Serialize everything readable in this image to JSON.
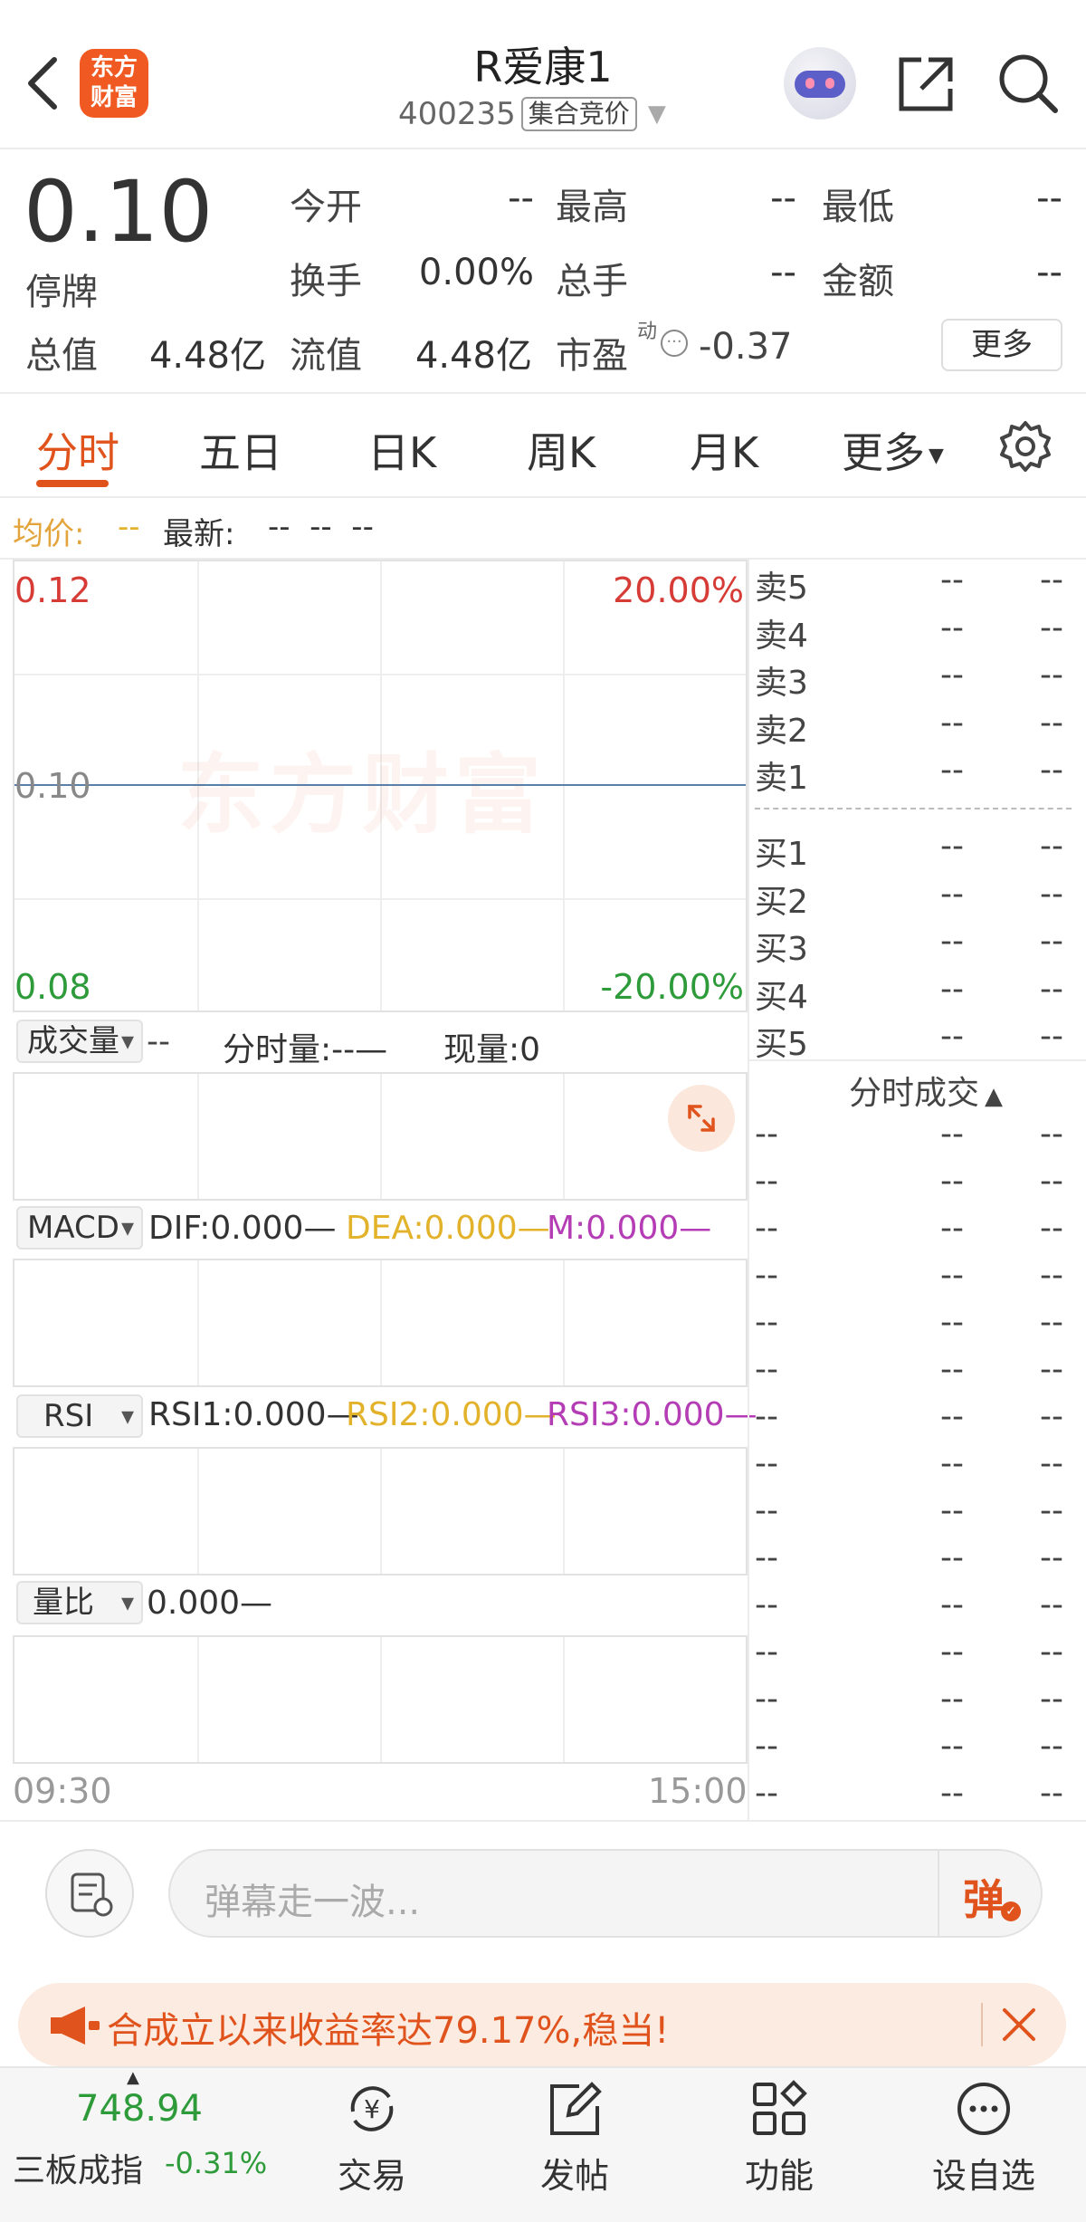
{
  "header": {
    "logo_text": "东方财富",
    "stock_name": "R爱康1",
    "code": "400235",
    "tag": "集合竞价"
  },
  "quote": {
    "price": "0.10",
    "status": "停牌",
    "open_label": "今开",
    "open": "--",
    "high_label": "最高",
    "high": "--",
    "low_label": "最低",
    "low": "--",
    "turnover_label": "换手",
    "turnover": "0.00%",
    "volume_label": "总手",
    "volume": "--",
    "amount_label": "金额",
    "amount": "--",
    "mcap_label": "总值",
    "mcap": "4.48亿",
    "float_label": "流值",
    "float": "4.48亿",
    "pe_label": "市盈",
    "pe_sup": "动",
    "pe": "-0.37",
    "more": "更多"
  },
  "tabs": [
    "分时",
    "五日",
    "日K",
    "周K",
    "月K",
    "更多"
  ],
  "infobar": {
    "avg_label": "均价:",
    "avg": "--",
    "latest_label": "最新:",
    "latest": "--  --  --"
  },
  "chart": {
    "watermark": "东方财富",
    "y_top": "0.12",
    "y_mid": "0.10",
    "y_bot": "0.08",
    "pct_top": "20.00%",
    "pct_bot": "-20.00%",
    "time_start": "09:30",
    "time_end": "15:00",
    "colors": {
      "up": "#d63b36",
      "down": "#2e9b3a",
      "line": "#5a7fa8",
      "avg": "#e3b22b"
    }
  },
  "volume": {
    "selector": "成交量",
    "value": "--",
    "min_vol": "分时量:--—",
    "now_vol": "现量:0"
  },
  "macd": {
    "selector": "MACD",
    "dif": "DIF:0.000—",
    "dea": "DEA:0.000—",
    "m": "M:0.000—"
  },
  "rsi": {
    "selector": "RSI",
    "r1": "RSI1:0.000—",
    "r2": "RSI2:0.000—",
    "r3": "RSI3:0.000—"
  },
  "lb": {
    "selector": "量比",
    "value": "0.000—"
  },
  "orderbook": {
    "asks": [
      {
        "label": "卖5",
        "p": "--",
        "v": "--"
      },
      {
        "label": "卖4",
        "p": "--",
        "v": "--"
      },
      {
        "label": "卖3",
        "p": "--",
        "v": "--"
      },
      {
        "label": "卖2",
        "p": "--",
        "v": "--"
      },
      {
        "label": "卖1",
        "p": "--",
        "v": "--"
      }
    ],
    "bids": [
      {
        "label": "买1",
        "p": "--",
        "v": "--"
      },
      {
        "label": "买2",
        "p": "--",
        "v": "--"
      },
      {
        "label": "买3",
        "p": "--",
        "v": "--"
      },
      {
        "label": "买4",
        "p": "--",
        "v": "--"
      },
      {
        "label": "买5",
        "p": "--",
        "v": "--"
      }
    ],
    "trades_title": "分时成交",
    "trade_cell": "--"
  },
  "danmaku": {
    "placeholder": "弹幕走一波...",
    "send": "弹"
  },
  "promo": {
    "text": "合成立以来收益率达79.17%,稳当!"
  },
  "bottom": {
    "index_value": "748.94",
    "index_name": "三板成指",
    "index_change": "-0.31%",
    "items": [
      "交易",
      "发帖",
      "功能",
      "设自选"
    ]
  }
}
